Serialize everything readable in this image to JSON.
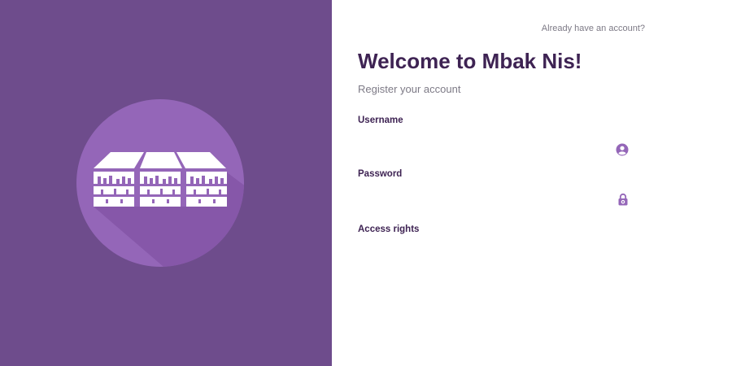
{
  "header": {
    "signin_prompt": "Already have an account?"
  },
  "main": {
    "title": "Welcome to Mbak Nis!",
    "subtitle": "Register your account"
  },
  "form": {
    "username": {
      "label": "Username",
      "value": "",
      "placeholder": "",
      "icon": "user-circle-icon"
    },
    "password": {
      "label": "Password",
      "value": "",
      "placeholder": "",
      "icon": "lock-icon"
    },
    "access_rights": {
      "label": "Access rights",
      "value": ""
    }
  },
  "colors": {
    "brand": "#6e4c8c",
    "brand_light": "#9466b8",
    "heading": "#3e2353",
    "muted": "#7d7a86",
    "icon": "#9466b8"
  },
  "icons": {
    "logo": "market-building-logo"
  }
}
